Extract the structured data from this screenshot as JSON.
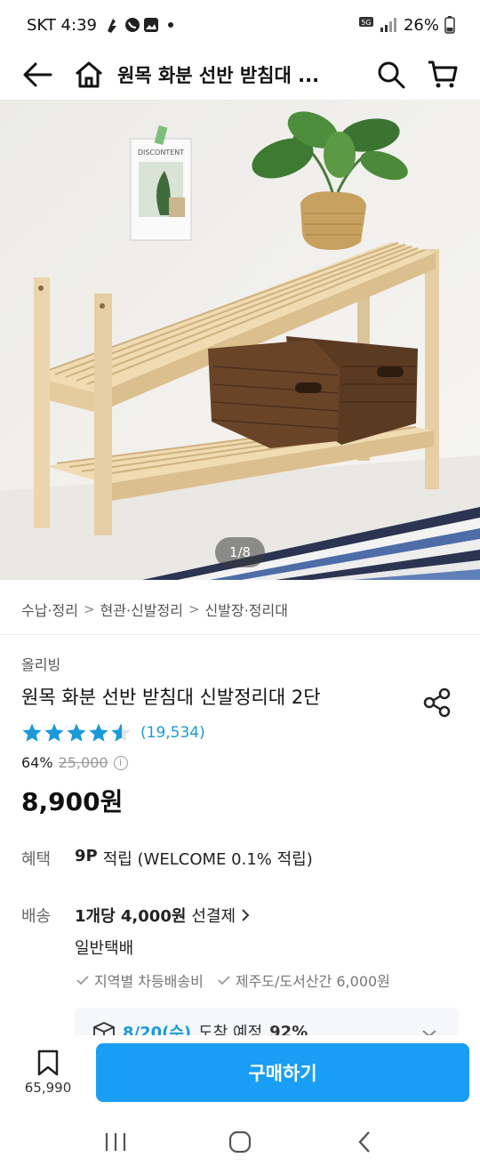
{
  "status_bar": {
    "carrier_time": "SKT 4:39",
    "network": "5G",
    "battery": "26%"
  },
  "nav": {
    "title": "원목 화분 선반 받침대 ..."
  },
  "gallery": {
    "counter": "1/8",
    "poster_text": "DISCONTENT"
  },
  "breadcrumb": [
    "수납·정리",
    "현관·신발정리",
    "신발장·정리대"
  ],
  "product": {
    "brand": "올리빙",
    "title": "원목 화분 선반 받침대 신발정리대 2단",
    "rating": 4.5,
    "review_count": "(19,534)",
    "discount": "64%",
    "original_price": "25,000",
    "price": "8,900원"
  },
  "benefit": {
    "label": "혜택",
    "points": "9P",
    "text": "적립 (WELCOME 0.1% 적립)"
  },
  "shipping": {
    "label": "배송",
    "fee": "1개당 4,000원",
    "pay": "선결제",
    "method": "일반택배",
    "notes": [
      "지역별 차등배송비",
      "제주도/도서산간 6,000원"
    ]
  },
  "delivery": {
    "date": "8/20(수)",
    "text": "도착 예정",
    "percent": "92%"
  },
  "bottom": {
    "scrap_count": "65,990",
    "buy_label": "구매하기"
  },
  "colors": {
    "accent": "#1a9ef5",
    "star": "#1a9ad9"
  }
}
